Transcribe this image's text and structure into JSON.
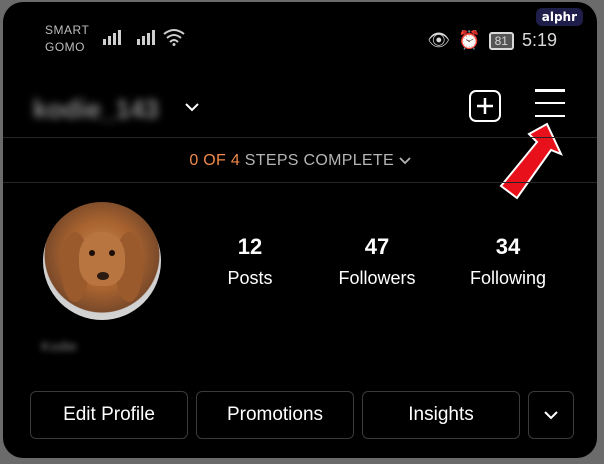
{
  "watermark": "alphr",
  "status_bar": {
    "carrier_line1": "SMART",
    "carrier_line2": "GOMO",
    "battery": "81",
    "time": "5:19"
  },
  "header": {
    "username": "kodie_143",
    "new_post_icon": "plus-square-icon",
    "menu_icon": "hamburger-menu-icon"
  },
  "steps": {
    "progress": "0 OF 4",
    "label": "STEPS COMPLETE"
  },
  "profile": {
    "display_name": "Kodie",
    "stats": [
      {
        "value": "12",
        "label": "Posts"
      },
      {
        "value": "47",
        "label": "Followers"
      },
      {
        "value": "34",
        "label": "Following"
      }
    ]
  },
  "actions": {
    "edit_profile": "Edit Profile",
    "promotions": "Promotions",
    "insights": "Insights"
  },
  "colors": {
    "background": "#000000",
    "steps_highlight": "#ef8a4a",
    "annotation_arrow": "#e8101a"
  }
}
